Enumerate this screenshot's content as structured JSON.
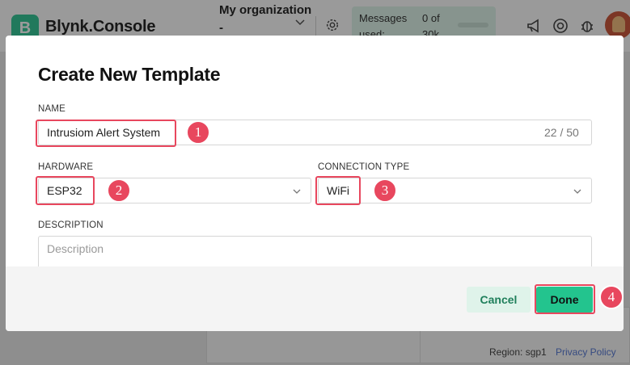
{
  "app": {
    "brand_letter": "B",
    "brand_name": "Blynk.Console",
    "org_label": "My organization -",
    "messages_label": "Messages used:",
    "messages_count": "0 of 30k",
    "messages_usage_fraction": 0.0,
    "region": "Region: sgp1",
    "privacy_policy": "Privacy Policy",
    "icons": [
      "settings-gear-icon",
      "megaphone-icon",
      "lifebuoy-icon",
      "bug-icon",
      "user-avatar"
    ]
  },
  "modal": {
    "title": "Create New Template",
    "name": {
      "label": "NAME",
      "value": "Intrusiom Alert System",
      "counter": "22 / 50"
    },
    "hardware": {
      "label": "HARDWARE",
      "value": "ESP32"
    },
    "connection_type": {
      "label": "CONNECTION TYPE",
      "value": "WiFi"
    },
    "description": {
      "label": "DESCRIPTION",
      "placeholder": "Description",
      "value": ""
    },
    "buttons": {
      "cancel": "Cancel",
      "done": "Done"
    }
  },
  "annotations": {
    "color": "#e8475e",
    "step_1": "1",
    "step_2": "2",
    "step_3": "3",
    "step_4": "4"
  }
}
